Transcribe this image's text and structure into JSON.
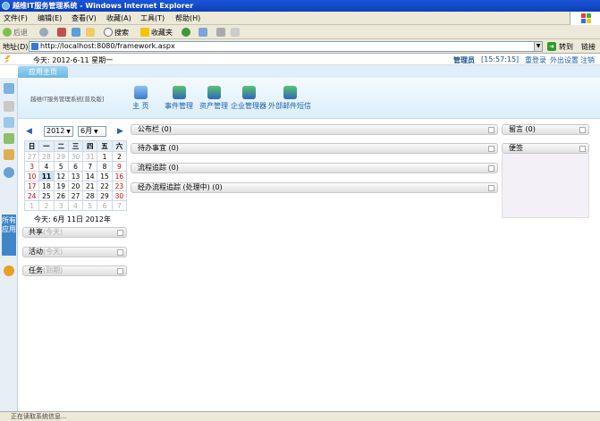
{
  "window": {
    "title": "越维IT服务管理系统 - Windows Internet Explorer"
  },
  "menu": {
    "items": [
      "文件(F)",
      "编辑(E)",
      "查看(V)",
      "收藏(A)",
      "工具(T)",
      "帮助(H)"
    ]
  },
  "toolbar": {
    "back": "后退",
    "search": "搜索",
    "favorites": "收藏夹"
  },
  "address": {
    "label": "地址(D)",
    "url": "http://localhost:8080/framework.aspx",
    "go": "转到",
    "links": "链接"
  },
  "info": {
    "date": "今天: 2012-6-11 星期一",
    "user": "管理员",
    "time": "[15:57:15]",
    "relogin": "重登录",
    "settings": "外出设置",
    "logout": "注销"
  },
  "tab": {
    "label": "应用主页"
  },
  "rail": {
    "all_apps": "所有应用"
  },
  "banner": {
    "title": "越维IT服务管理系统[普及版]"
  },
  "nav": [
    {
      "label": "主 页",
      "icon": "home-icon"
    },
    {
      "label": "事件管理",
      "icon": "event-icon"
    },
    {
      "label": "资产管理",
      "icon": "asset-icon"
    },
    {
      "label": "企业管理器",
      "icon": "enterprise-icon"
    },
    {
      "label": "外部邮件短信",
      "icon": "mail-icon"
    }
  ],
  "calendar": {
    "year": "2012",
    "month": "6月",
    "weekdays": [
      "日",
      "一",
      "二",
      "三",
      "四",
      "五",
      "六"
    ],
    "weeks": [
      [
        "27",
        "28",
        "29",
        "30",
        "31",
        "1",
        "2"
      ],
      [
        "3",
        "4",
        "5",
        "6",
        "7",
        "8",
        "9"
      ],
      [
        "10",
        "11",
        "12",
        "13",
        "14",
        "15",
        "16"
      ],
      [
        "17",
        "18",
        "19",
        "20",
        "21",
        "22",
        "23"
      ],
      [
        "24",
        "25",
        "26",
        "27",
        "28",
        "29",
        "30"
      ],
      [
        "1",
        "2",
        "3",
        "4",
        "5",
        "6",
        "7"
      ]
    ],
    "today_text": "今天: 6月 11日 2012年"
  },
  "left_boxes": [
    {
      "title": "共享",
      "sub": "(今天)"
    },
    {
      "title": "活动",
      "sub": "(今天)"
    },
    {
      "title": "任务",
      "sub": "(到期)"
    }
  ],
  "center_boxes": [
    "公布栏 (0)",
    "待办事宜 (0)",
    "流程追踪 (0)",
    "经办流程追踪 (处理中) (0)"
  ],
  "right_boxes": [
    "留言 (0)",
    "便签"
  ],
  "status": {
    "text": "正在读取系统信息..."
  },
  "colors": {
    "accent": "#3f86c8",
    "titlebar": "#0b3fb8",
    "chrome": "#ece9d8"
  }
}
